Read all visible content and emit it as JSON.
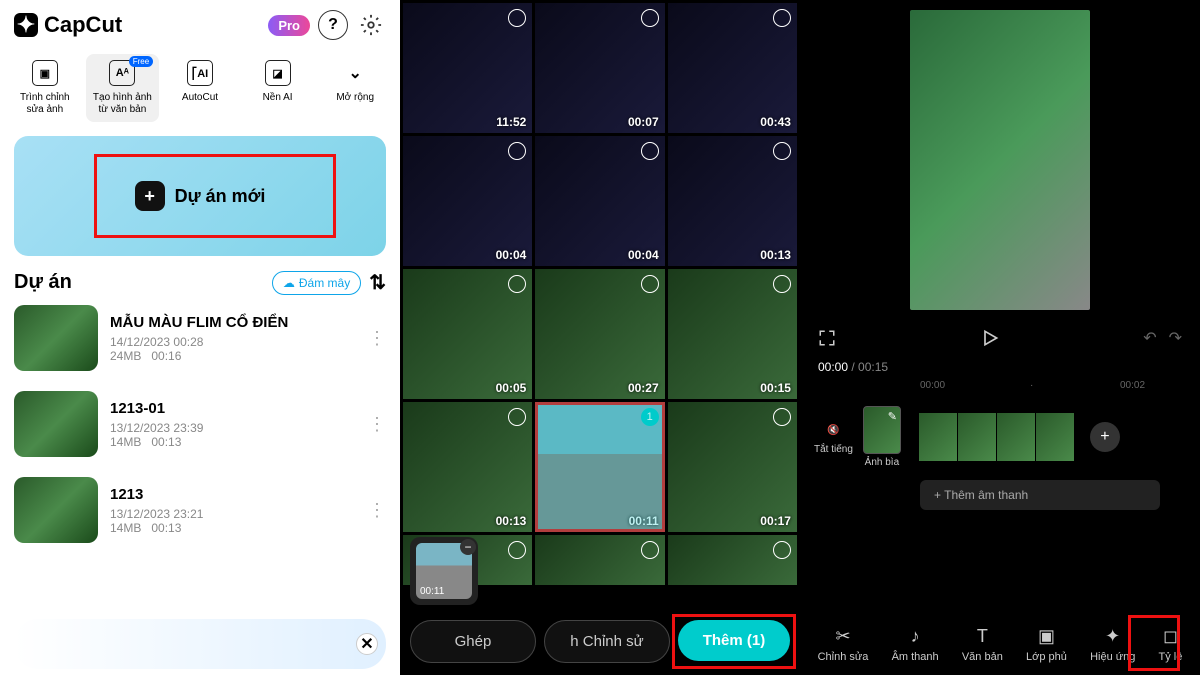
{
  "p1": {
    "app": "CapCut",
    "pro": "Pro",
    "tools": [
      {
        "label": "Trình chỉnh sửa ảnh"
      },
      {
        "label": "Tạo hình ảnh từ văn bản",
        "free": "Free"
      },
      {
        "label": "AutoCut"
      },
      {
        "label": "Nền AI"
      },
      {
        "label": "Mở rộng"
      }
    ],
    "new_project": "Dự án mới",
    "section": "Dự án",
    "cloud": "Đám mây",
    "projects": [
      {
        "title": "MẪU MÀU FLIM CỔ ĐIỂN",
        "date": "14/12/2023 00:28",
        "size": "24MB",
        "dur": "00:16"
      },
      {
        "title": "1213-01",
        "date": "13/12/2023 23:39",
        "size": "14MB",
        "dur": "00:13"
      },
      {
        "title": "1213",
        "date": "13/12/2023 23:21",
        "size": "14MB",
        "dur": "00:13"
      }
    ]
  },
  "p2": {
    "cells": [
      {
        "d": "11:52",
        "n": true
      },
      {
        "d": "00:07",
        "n": true
      },
      {
        "d": "00:43",
        "n": true
      },
      {
        "d": "00:04",
        "n": true
      },
      {
        "d": "00:04",
        "n": true
      },
      {
        "d": "00:13",
        "n": true
      },
      {
        "d": "00:05"
      },
      {
        "d": "00:27"
      },
      {
        "d": "00:15"
      },
      {
        "d": "00:13"
      },
      {
        "d": "00:11",
        "sel": true,
        "num": "1",
        "road": true
      },
      {
        "d": "00:17"
      }
    ],
    "selected_dur": "00:11",
    "actions": {
      "merge": "Ghép",
      "edit": "h   Chỉnh sử",
      "add": "Thêm (1)"
    }
  },
  "p3": {
    "time_cur": "00:00",
    "time_tot": "00:15",
    "ruler": [
      "00:00",
      "00:02"
    ],
    "mute": "Tắt tiếng",
    "cover": "Ảnh bìa",
    "add_audio": "+  Thêm âm thanh",
    "tools": [
      {
        "l": "Chỉnh sửa",
        "i": "✂"
      },
      {
        "l": "Âm thanh",
        "i": "♪"
      },
      {
        "l": "Văn bản",
        "i": "T"
      },
      {
        "l": "Lớp phủ",
        "i": "▣"
      },
      {
        "l": "Hiệu ứng",
        "i": "✦"
      },
      {
        "l": "Tỷ lệ",
        "i": "◻"
      }
    ]
  }
}
